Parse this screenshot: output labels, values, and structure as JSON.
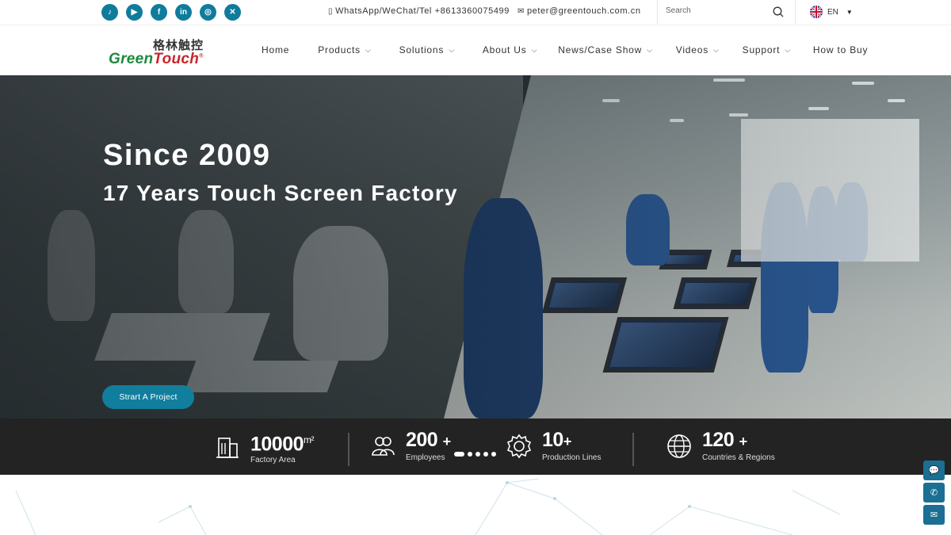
{
  "topbar": {
    "social": [
      {
        "name": "tiktok",
        "glyph": "♪"
      },
      {
        "name": "youtube",
        "glyph": "▶"
      },
      {
        "name": "facebook",
        "glyph": "f"
      },
      {
        "name": "linkedin",
        "glyph": "in"
      },
      {
        "name": "instagram",
        "glyph": "◎"
      },
      {
        "name": "x",
        "glyph": "✕"
      }
    ],
    "phone": "WhatsApp/WeChat/Tel +8613360075499",
    "email": "peter@greentouch.com.cn",
    "search_placeholder": "Search",
    "language": "EN"
  },
  "logo": {
    "cn": "格林触控",
    "en_a": "Green",
    "en_b": "Touch",
    "reg": "®"
  },
  "nav": [
    {
      "label": "Home",
      "dropdown": false
    },
    {
      "label": "Products",
      "dropdown": true
    },
    {
      "label": "Solutions",
      "dropdown": true
    },
    {
      "label": "About Us",
      "dropdown": true
    },
    {
      "label": "News/Case Show",
      "dropdown": true
    },
    {
      "label": "Videos",
      "dropdown": true
    },
    {
      "label": "Support",
      "dropdown": true
    },
    {
      "label": "How to Buy",
      "dropdown": false
    }
  ],
  "hero": {
    "title": "Since 2009",
    "subtitle": "17 Years Touch Screen Factory",
    "cta": "Strart A Project"
  },
  "stats": [
    {
      "value": "10000",
      "unit": "m²",
      "label": "Factory Area",
      "icon": "building-icon"
    },
    {
      "value": "200",
      "unit": "+",
      "label": "Employees",
      "icon": "employees-icon"
    },
    {
      "value": "10",
      "unit": "+",
      "label": "Production Lines",
      "icon": "gear-icon"
    },
    {
      "value": "120",
      "unit": "+",
      "label": "Countries & Regions",
      "icon": "globe-icon"
    }
  ],
  "float_buttons": [
    {
      "name": "wechat",
      "glyph": "💬"
    },
    {
      "name": "whatsapp",
      "glyph": "✆"
    },
    {
      "name": "email",
      "glyph": "✉"
    }
  ],
  "colors": {
    "accent": "#117e9d",
    "logo_red": "#c9262c",
    "logo_green": "#1c8a3c",
    "stats_bg": "#232323"
  }
}
